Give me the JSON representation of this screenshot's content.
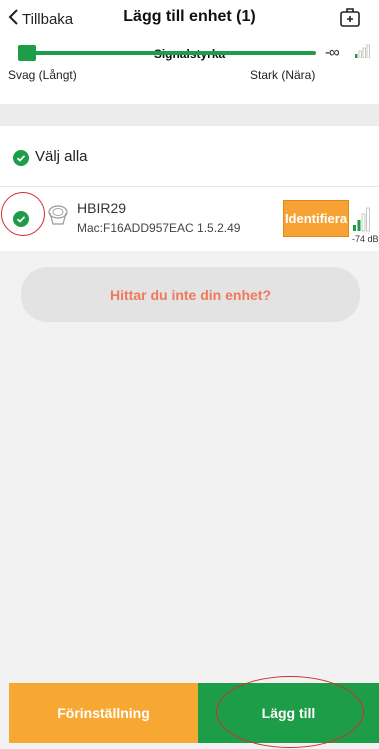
{
  "header": {
    "back_label": "Tillbaka",
    "title": "Lägg till enhet (1)"
  },
  "signal": {
    "title": "Signalstyrka",
    "weak_label": "Svag (Långt)",
    "strong_label": "Stark (Nära)",
    "threshold_label": "-∞",
    "slider_level": 0.0
  },
  "select_all": {
    "label": "Välj alla",
    "checked": true
  },
  "device": {
    "name": "HBIR29",
    "mac_line": "Mac:F16ADD957EAC  1.5.2.49",
    "identify_label": "Identifiera",
    "rssi_label": "-74 dB",
    "checked": true
  },
  "cant_find_label": "Hittar du inte din enhet?",
  "bottom": {
    "preset_label": "Förinställning",
    "add_label": "Lägg till"
  },
  "colors": {
    "green": "#1e9d48",
    "orange": "#f7a832",
    "accent_text": "#f1785a",
    "annotation_red": "#d42a33"
  }
}
